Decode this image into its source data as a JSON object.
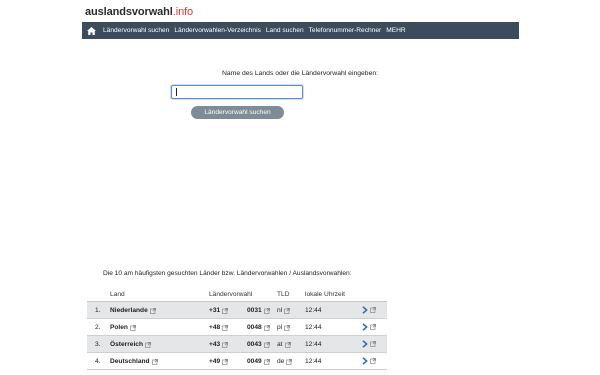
{
  "logo": {
    "name": "auslandsvorwahl",
    "tld": ".info"
  },
  "nav": {
    "home_icon": "home-icon",
    "items": [
      "Ländervorwahl suchen",
      "Ländervorwahlen-Verzeichnis",
      "Land suchen",
      "Telefonnummer-Rechner",
      "MEHR"
    ]
  },
  "search": {
    "label": "Name des Lands oder die Ländervorwahl eingeben:",
    "value": "",
    "placeholder": "",
    "button_label": "Ländervorwahl suchen"
  },
  "top10": {
    "heading": "Die 10 am häufigsten gesuchten Länder bzw. Ländervorwahlen / Auslandsvorwahlen:",
    "columns": [
      "Land",
      "Ländervorwahl",
      "TLD",
      "lokale Uhrzeit"
    ],
    "rows": [
      {
        "rank": "1.",
        "country": "Niederlande",
        "code": "+31",
        "intl": "0031",
        "tld": "nl",
        "time": "12:44"
      },
      {
        "rank": "2.",
        "country": "Polen",
        "code": "+48",
        "intl": "0048",
        "tld": "pl",
        "time": "12:44"
      },
      {
        "rank": "3.",
        "country": "Österreich",
        "code": "+43",
        "intl": "0043",
        "tld": "at",
        "time": "12:44"
      },
      {
        "rank": "4.",
        "country": "Deutschland",
        "code": "+49",
        "intl": "0049",
        "tld": "de",
        "time": "12:44"
      }
    ]
  },
  "colors": {
    "navbar": "#3b4c5c",
    "logo_tld": "#d13a2f",
    "button": "#7f8b97",
    "arrow": "#2e6fc4",
    "row_alt": "#e4e6e8"
  }
}
